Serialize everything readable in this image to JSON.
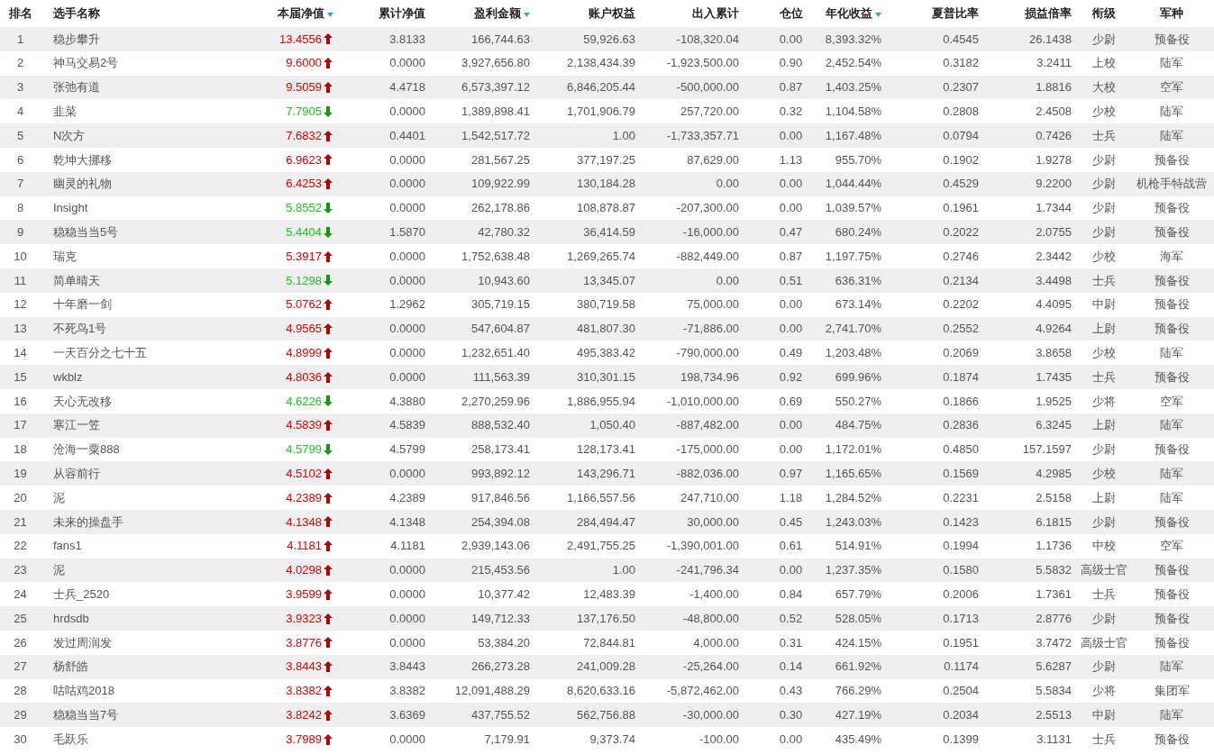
{
  "columns": [
    {
      "label": "排名",
      "sort_indicator": false
    },
    {
      "label": "选手名称",
      "sort_indicator": false
    },
    {
      "label": "本届净值",
      "sort_indicator": true
    },
    {
      "label": "累计净值",
      "sort_indicator": false
    },
    {
      "label": "盈利金额",
      "sort_indicator": true
    },
    {
      "label": "账户权益",
      "sort_indicator": false
    },
    {
      "label": "出入累计",
      "sort_indicator": false
    },
    {
      "label": "仓位",
      "sort_indicator": false
    },
    {
      "label": "年化收益",
      "sort_indicator": true
    },
    {
      "label": "夏普比率",
      "sort_indicator": false
    },
    {
      "label": "损益倍率",
      "sort_indicator": false
    },
    {
      "label": "衔级",
      "sort_indicator": false
    },
    {
      "label": "军种",
      "sort_indicator": false
    }
  ],
  "rows": [
    {
      "rising": true,
      "cells": [
        "1",
        "稳步攀升",
        "13.4556",
        "3.8133",
        "166,744.63",
        "59,926.63",
        "-108,320.04",
        "0.00",
        "8,393.32%",
        "0.4545",
        "26.1438",
        "少尉",
        "预备役"
      ]
    },
    {
      "rising": true,
      "cells": [
        "2",
        "神马交易2号",
        "9.6000",
        "0.0000",
        "3,927,656.80",
        "2,138,434.39",
        "-1,923,500.00",
        "0.90",
        "2,452.54%",
        "0.3182",
        "3.2411",
        "上校",
        "陆军"
      ]
    },
    {
      "rising": true,
      "cells": [
        "3",
        "张弛有道",
        "9.5059",
        "4.4718",
        "6,573,397.12",
        "6,846,205.44",
        "-500,000.00",
        "0.87",
        "1,403.25%",
        "0.2307",
        "1.8816",
        "大校",
        "空军"
      ]
    },
    {
      "rising": false,
      "cells": [
        "4",
        "韭菜",
        "7.7905",
        "0.0000",
        "1,389,898.41",
        "1,701,906.79",
        "257,720.00",
        "0.32",
        "1,104.58%",
        "0.2808",
        "2.4508",
        "少校",
        "陆军"
      ]
    },
    {
      "rising": true,
      "cells": [
        "5",
        "N次方",
        "7.6832",
        "0.4401",
        "1,542,517.72",
        "1.00",
        "-1,733,357.71",
        "0.00",
        "1,167.48%",
        "0.0794",
        "0.7426",
        "士兵",
        "陆军"
      ]
    },
    {
      "rising": true,
      "cells": [
        "6",
        "乾坤大挪移",
        "6.9623",
        "0.0000",
        "281,567.25",
        "377,197.25",
        "87,629.00",
        "1.13",
        "955.70%",
        "0.1902",
        "1.9278",
        "少尉",
        "预备役"
      ]
    },
    {
      "rising": true,
      "cells": [
        "7",
        "幽灵的礼物",
        "6.4253",
        "0.0000",
        "109,922.99",
        "130,184.28",
        "0.00",
        "0.00",
        "1,044.44%",
        "0.4529",
        "9.2200",
        "少尉",
        "机枪手特战营"
      ]
    },
    {
      "rising": false,
      "cells": [
        "8",
        "Insight",
        "5.8552",
        "0.0000",
        "262,178.86",
        "108,878.87",
        "-207,300.00",
        "0.00",
        "1,039.57%",
        "0.1961",
        "1.7344",
        "少尉",
        "预备役"
      ]
    },
    {
      "rising": false,
      "cells": [
        "9",
        "稳稳当当5号",
        "5.4404",
        "1.5870",
        "42,780.32",
        "36,414.59",
        "-16,000.00",
        "0.47",
        "680.24%",
        "0.2022",
        "2.0755",
        "少尉",
        "预备役"
      ]
    },
    {
      "rising": true,
      "cells": [
        "10",
        "瑞克",
        "5.3917",
        "0.0000",
        "1,752,638.48",
        "1,269,265.74",
        "-882,449.00",
        "0.87",
        "1,197.75%",
        "0.2746",
        "2.3442",
        "少校",
        "海军"
      ]
    },
    {
      "rising": false,
      "cells": [
        "11",
        "简单晴天",
        "5.1298",
        "0.0000",
        "10,943.60",
        "13,345.07",
        "0.00",
        "0.51",
        "636.31%",
        "0.2134",
        "3.4498",
        "士兵",
        "预备役"
      ]
    },
    {
      "rising": true,
      "cells": [
        "12",
        "十年磨一剑",
        "5.0762",
        "1.2962",
        "305,719.15",
        "380,719.58",
        "75,000.00",
        "0.00",
        "673.14%",
        "0.2202",
        "4.4095",
        "中尉",
        "预备役"
      ]
    },
    {
      "rising": true,
      "cells": [
        "13",
        "不死鸟1号",
        "4.9565",
        "0.0000",
        "547,604.87",
        "481,807.30",
        "-71,886.00",
        "0.00",
        "2,741.70%",
        "0.2552",
        "4.9264",
        "上尉",
        "预备役"
      ]
    },
    {
      "rising": true,
      "cells": [
        "14",
        "一天百分之七十五",
        "4.8999",
        "0.0000",
        "1,232,651.40",
        "495,383.42",
        "-790,000.00",
        "0.49",
        "1,203.48%",
        "0.2069",
        "3.8658",
        "少校",
        "陆军"
      ]
    },
    {
      "rising": true,
      "cells": [
        "15",
        "wkblz",
        "4.8036",
        "0.0000",
        "111,563.39",
        "310,301.15",
        "198,734.96",
        "0.92",
        "699.96%",
        "0.1874",
        "1.7435",
        "士兵",
        "预备役"
      ]
    },
    {
      "rising": false,
      "cells": [
        "16",
        "天心无改移",
        "4.6226",
        "4.3880",
        "2,270,259.96",
        "1,886,955.94",
        "-1,010,000.00",
        "0.69",
        "550.27%",
        "0.1866",
        "1.9525",
        "少将",
        "空军"
      ]
    },
    {
      "rising": true,
      "cells": [
        "17",
        "寒江一笠",
        "4.5839",
        "4.5839",
        "888,532.40",
        "1,050.40",
        "-887,482.00",
        "0.00",
        "484.75%",
        "0.2836",
        "6.3245",
        "上尉",
        "陆军"
      ]
    },
    {
      "rising": false,
      "cells": [
        "18",
        "沧海一粟888",
        "4.5799",
        "4.5799",
        "258,173.41",
        "128,173.41",
        "-175,000.00",
        "0.00",
        "1,172.01%",
        "0.4850",
        "157.1597",
        "少尉",
        "预备役"
      ]
    },
    {
      "rising": true,
      "cells": [
        "19",
        "从容前行",
        "4.5102",
        "0.0000",
        "993,892.12",
        "143,296.71",
        "-882,036.00",
        "0.97",
        "1,165.65%",
        "0.1569",
        "4.2985",
        "少校",
        "陆军"
      ]
    },
    {
      "rising": true,
      "cells": [
        "20",
        "泥",
        "4.2389",
        "4.2389",
        "917,846.56",
        "1,166,557.56",
        "247,710.00",
        "1.18",
        "1,284.52%",
        "0.2231",
        "2.5158",
        "上尉",
        "陆军"
      ]
    },
    {
      "rising": true,
      "cells": [
        "21",
        "未来的操盘手",
        "4.1348",
        "4.1348",
        "254,394.08",
        "284,494.47",
        "30,000.00",
        "0.45",
        "1,243.03%",
        "0.1423",
        "6.1815",
        "少尉",
        "预备役"
      ]
    },
    {
      "rising": true,
      "cells": [
        "22",
        "fans1",
        "4.1181",
        "4.1181",
        "2,939,143.06",
        "2,491,755.25",
        "-1,390,001.00",
        "0.61",
        "514.91%",
        "0.1994",
        "1.1736",
        "中校",
        "空军"
      ]
    },
    {
      "rising": true,
      "cells": [
        "23",
        "泥",
        "4.0298",
        "0.0000",
        "215,453.56",
        "1.00",
        "-241,796.34",
        "0.00",
        "1,237.35%",
        "0.1580",
        "5.5832",
        "高级士官",
        "预备役"
      ]
    },
    {
      "rising": true,
      "cells": [
        "24",
        "士兵_2520",
        "3.9599",
        "0.0000",
        "10,377.42",
        "12,483.39",
        "-1,400.00",
        "0.84",
        "657.79%",
        "0.2006",
        "1.7361",
        "士兵",
        "预备役"
      ]
    },
    {
      "rising": true,
      "cells": [
        "25",
        "hrdsdb",
        "3.9323",
        "0.0000",
        "149,712.33",
        "137,176.50",
        "-48,800.00",
        "0.52",
        "528.05%",
        "0.1713",
        "2.8776",
        "少尉",
        "预备役"
      ]
    },
    {
      "rising": true,
      "cells": [
        "26",
        "发过周润发",
        "3.8776",
        "0.0000",
        "53,384.20",
        "72,844.81",
        "4,000.00",
        "0.31",
        "424.15%",
        "0.1951",
        "3.7472",
        "高级士官",
        "预备役"
      ]
    },
    {
      "rising": true,
      "cells": [
        "27",
        "杨舒皓",
        "3.8443",
        "3.8443",
        "266,273.28",
        "241,009.28",
        "-25,264.00",
        "0.14",
        "661.92%",
        "0.1174",
        "5.6287",
        "少尉",
        "陆军"
      ]
    },
    {
      "rising": true,
      "cells": [
        "28",
        "咕咕鸡2018",
        "3.8382",
        "3.8382",
        "12,091,488.29",
        "8,620,633.16",
        "-5,872,462.00",
        "0.43",
        "766.29%",
        "0.2504",
        "5.5834",
        "少将",
        "集团军"
      ]
    },
    {
      "rising": true,
      "cells": [
        "29",
        "稳稳当当7号",
        "3.8242",
        "3.6369",
        "437,755.52",
        "562,756.88",
        "-30,000.00",
        "0.30",
        "427.19%",
        "0.2034",
        "2.5513",
        "中尉",
        "陆军"
      ]
    },
    {
      "rising": true,
      "cells": [
        "30",
        "毛跃乐",
        "3.7989",
        "0.0000",
        "7,179.91",
        "9,373.74",
        "-100.00",
        "0.00",
        "435.49%",
        "0.1399",
        "3.1131",
        "士兵",
        "预备役"
      ]
    }
  ]
}
